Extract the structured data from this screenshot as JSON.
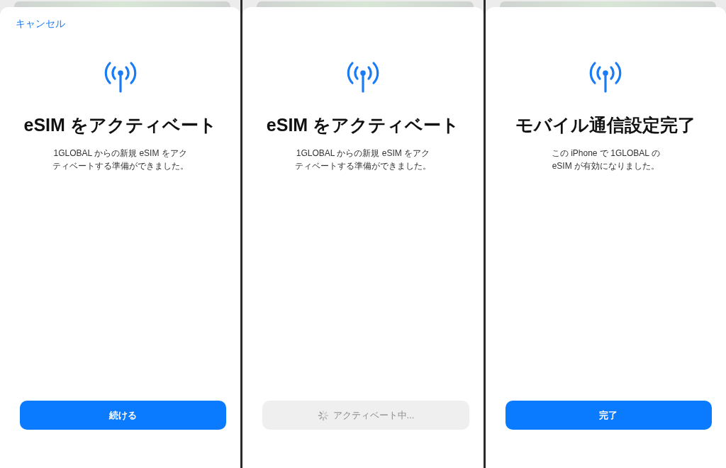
{
  "screens": [
    {
      "cancel": "キャンセル",
      "title": "eSIM をアクティベート",
      "message_lines": [
        "1GLOBAL からの新規 eSIM をアク",
        "ティベートする準備ができました。"
      ],
      "button": {
        "label": "続ける",
        "disabled": false,
        "loading": false
      }
    },
    {
      "title": "eSIM をアクティベート",
      "message_lines": [
        "1GLOBAL からの新規 eSIM をアク",
        "ティベートする準備ができました。"
      ],
      "button": {
        "label": "アクティベート中...",
        "disabled": true,
        "loading": true
      }
    },
    {
      "title": "モバイル通信設定完了",
      "message_lines": [
        "この iPhone で 1GLOBAL の",
        "eSIM が有効になりました。"
      ],
      "button": {
        "label": "完了",
        "disabled": false,
        "loading": false
      }
    }
  ]
}
